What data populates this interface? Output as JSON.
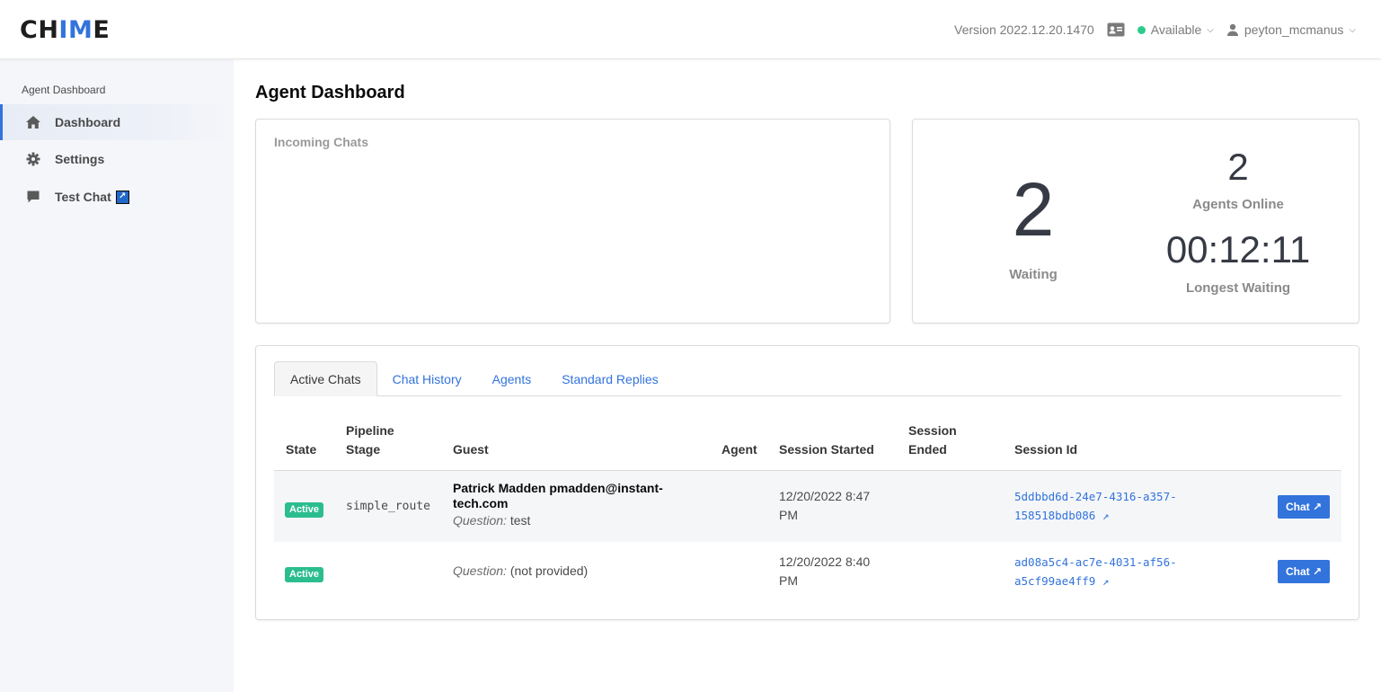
{
  "header": {
    "logo_prefix": "CH",
    "logo_accent": "IM",
    "logo_suffix": "E",
    "version": "Version 2022.12.20.1470",
    "status": "Available",
    "username": "peyton_mcmanus"
  },
  "sidebar": {
    "title": "Agent Dashboard",
    "items": [
      {
        "label": "Dashboard",
        "icon": "home-icon"
      },
      {
        "label": "Settings",
        "icon": "gear-icon"
      },
      {
        "label": "Test Chat",
        "icon": "chat-bubble-icon"
      }
    ]
  },
  "main": {
    "title": "Agent Dashboard",
    "incoming_title": "Incoming Chats",
    "stats": {
      "waiting_value": "2",
      "waiting_label": "Waiting",
      "agents_value": "2",
      "agents_label": "Agents Online",
      "longest_value": "00:12:11",
      "longest_label": "Longest Waiting"
    },
    "tabs": [
      "Active Chats",
      "Chat History",
      "Agents",
      "Standard Replies"
    ],
    "table": {
      "columns": [
        "State",
        "Pipeline Stage",
        "Guest",
        "Agent",
        "Session Started",
        "Session Ended",
        "Session Id"
      ],
      "column_lines": {
        "pipeline_1": "Pipeline",
        "pipeline_2": "Stage",
        "ended_1": "Session",
        "ended_2": "Ended"
      },
      "question_label": "Question:",
      "rows": [
        {
          "state": "Active",
          "pipeline": "simple_route",
          "guest_name": "Patrick Madden pmadden@instant-",
          "guest_name_2": "tech.com",
          "question": "test",
          "agent": "",
          "started_1": "12/20/2022 8:47",
          "started_2": "PM",
          "ended": "",
          "session_1": "5ddbbd6d-24e7-4316-a357-",
          "session_2": "158518bdb086 ↗",
          "button": "Chat ↗"
        },
        {
          "state": "Active",
          "pipeline": "",
          "guest_name": "",
          "question": "(not provided)",
          "agent": "",
          "started_1": "12/20/2022 8:40",
          "started_2": "PM",
          "ended": "",
          "session_1": "ad08a5c4-ac7e-4031-af56-",
          "session_2": "a5cf99ae4ff9 ↗",
          "button": "Chat ↗"
        }
      ]
    }
  },
  "colors": {
    "accent": "#3273dc",
    "status_green": "#2ecc8c",
    "tag_green": "#2bbd8e"
  }
}
